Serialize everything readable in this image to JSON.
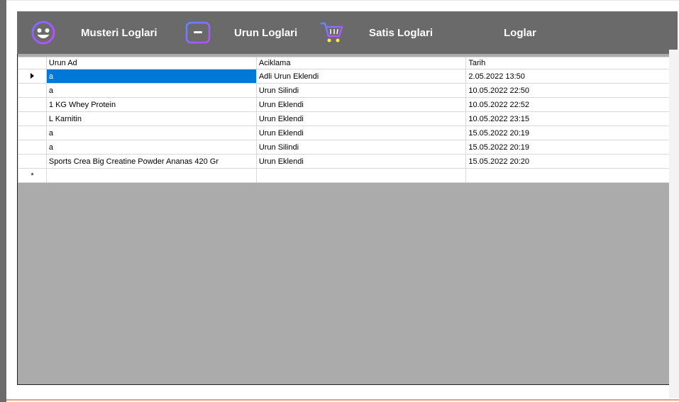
{
  "nav": {
    "items": [
      {
        "label": "Musteri Loglari",
        "icon": "smiley-icon"
      },
      {
        "label": "Urun Loglari",
        "icon": "box-icon"
      },
      {
        "label": "Satis Loglari",
        "icon": "cart-icon"
      },
      {
        "label": "Loglar"
      }
    ]
  },
  "grid": {
    "columns": [
      "Urun Ad",
      "Aciklama",
      "Tarih"
    ],
    "rows": [
      {
        "urun_ad": "a",
        "aciklama": "Adli Urun Eklendi",
        "tarih": "2.05.2022 13:50"
      },
      {
        "urun_ad": "a",
        "aciklama": "Urun Silindi",
        "tarih": "10.05.2022 22:50"
      },
      {
        "urun_ad": "1 KG Whey Protein",
        "aciklama": "Urun Eklendi",
        "tarih": "10.05.2022 22:52"
      },
      {
        "urun_ad": "L Karnitin",
        "aciklama": "Urun Eklendi",
        "tarih": "10.05.2022 23:15"
      },
      {
        "urun_ad": "a",
        "aciklama": "Urun Eklendi",
        "tarih": "15.05.2022 20:19"
      },
      {
        "urun_ad": "a",
        "aciklama": "Urun Silindi",
        "tarih": "15.05.2022 20:19"
      },
      {
        "urun_ad": "Sports Crea Big Creatine Powder Ananas 420 Gr",
        "aciklama": "Urun Eklendi",
        "tarih": "15.05.2022 20:20"
      }
    ],
    "new_row_marker": "*"
  },
  "colors": {
    "toolbar": "#6a6a6a",
    "panel": "#ababab",
    "selection": "#0078d7",
    "icon_accent": "#a040ff"
  }
}
